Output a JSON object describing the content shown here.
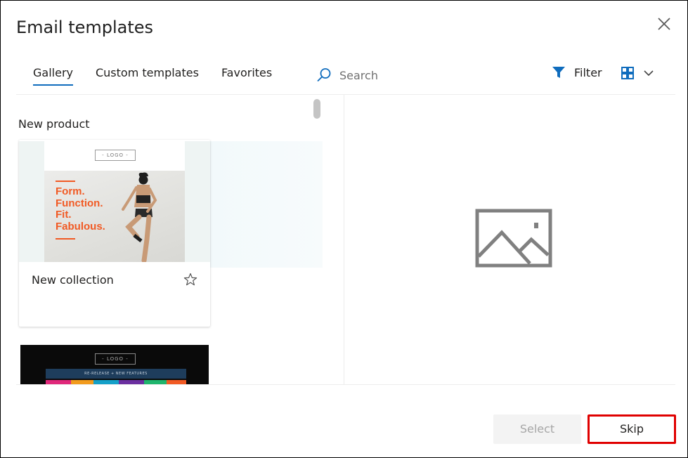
{
  "dialog": {
    "title": "Email templates",
    "close_label": "Close"
  },
  "tabs": [
    {
      "label": "Gallery",
      "active": true
    },
    {
      "label": "Custom templates",
      "active": false
    },
    {
      "label": "Favorites",
      "active": false
    }
  ],
  "search": {
    "placeholder": "Search",
    "value": ""
  },
  "filter": {
    "label": "Filter"
  },
  "gallery": {
    "section_title": "New product",
    "templates": [
      {
        "label": "New collection",
        "favorite": false,
        "thumbnail": {
          "logo_text": "LOGO",
          "headline": [
            "Form.",
            "Function.",
            "Fit.",
            "Fabulous."
          ]
        }
      },
      {
        "label": "",
        "thumbnail": {
          "logo_text": "LOGO",
          "band_text": "RE-RELEASE + NEW FEATURES"
        }
      }
    ]
  },
  "preview": {
    "icon": "image-placeholder-icon"
  },
  "footer": {
    "select_label": "Select",
    "skip_label": "Skip"
  },
  "colors": {
    "accent": "#0f6cbd",
    "highlight_border": "#e00000",
    "headline_orange": "#f15a24"
  }
}
